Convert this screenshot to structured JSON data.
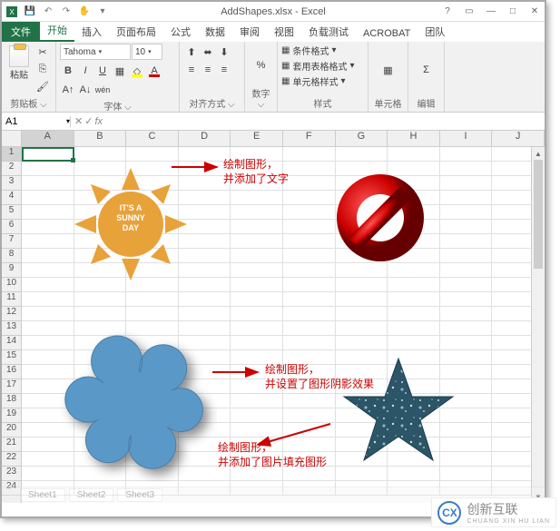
{
  "title": "AddShapes.xlsx - Excel",
  "qat": {
    "save": "💾",
    "undo": "↶",
    "redo": "↷",
    "touch": "✋"
  },
  "tabs": {
    "file": "文件",
    "items": [
      "开始",
      "插入",
      "页面布局",
      "公式",
      "数据",
      "审阅",
      "视图",
      "负载测试",
      "ACROBAT",
      "团队"
    ],
    "active_index": 0
  },
  "ribbon": {
    "clipboard": {
      "label": "剪贴板",
      "paste": "粘贴"
    },
    "font": {
      "label": "字体",
      "name": "Tahoma",
      "size": "10",
      "bold": "B",
      "italic": "I",
      "underline": "U"
    },
    "align": {
      "label": "对齐方式"
    },
    "number": {
      "label": "数字"
    },
    "styles": {
      "label": "样式",
      "cond": "条件格式",
      "table": "套用表格格式",
      "cell": "单元格样式"
    },
    "cells": {
      "label": "单元格"
    },
    "editing": {
      "label": "编辑"
    }
  },
  "namebox": "A1",
  "fx": "fx",
  "columns": [
    "A",
    "B",
    "C",
    "D",
    "E",
    "F",
    "G",
    "H",
    "I",
    "J"
  ],
  "rows": 24,
  "shapes": {
    "sun_text": "IT'S A SUNNY DAY",
    "annot1_l1": "绘制图形，",
    "annot1_l2": "并添加了文字",
    "annot2_l1": "绘制图形，",
    "annot2_l2": "并设置了图形阴影效果",
    "annot3_l1": "绘制图形，",
    "annot3_l2": "并添加了图片填充图形"
  },
  "sheets": [
    "Sheet1",
    "Sheet2",
    "Sheet3"
  ],
  "watermark": {
    "logo": "CX",
    "brand": "创新互联",
    "sub": "CHUANG XIN HU LIAN"
  }
}
